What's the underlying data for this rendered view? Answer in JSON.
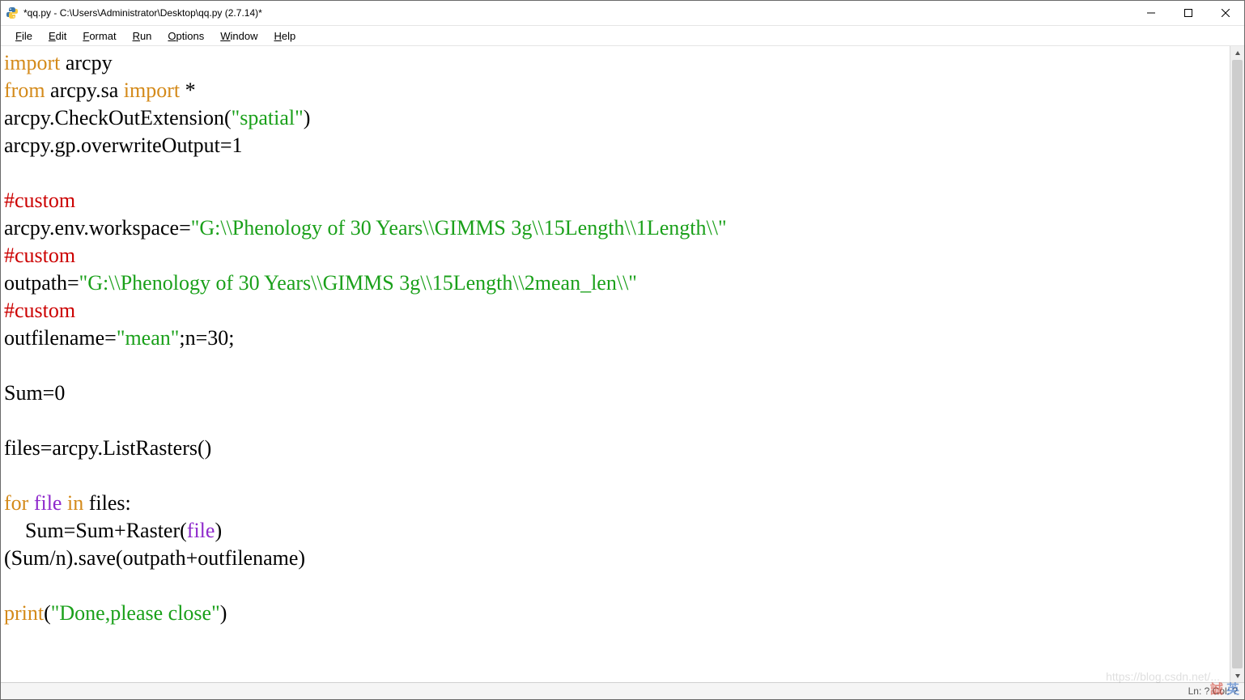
{
  "window": {
    "title": "*qq.py - C:\\Users\\Administrator\\Desktop\\qq.py (2.7.14)*"
  },
  "menu": {
    "file": {
      "u": "F",
      "rest": "ile"
    },
    "edit": {
      "u": "E",
      "rest": "dit"
    },
    "format": {
      "u": "F",
      "rest": "ormat"
    },
    "run": {
      "u": "R",
      "rest": "un"
    },
    "options": {
      "u": "O",
      "rest": "ptions"
    },
    "window": {
      "u": "W",
      "rest": "indow"
    },
    "help": {
      "u": "H",
      "rest": "elp"
    }
  },
  "code": {
    "l1_import": "import",
    "l1_rest": " arcpy",
    "l2_from": "from",
    "l2_mid": " arcpy.sa ",
    "l2_import": "import",
    "l2_end": " *",
    "l3_a": "arcpy.CheckOutExtension(",
    "l3_str": "\"spatial\"",
    "l3_b": ")",
    "l4": "arcpy.gp.overwriteOutput=1",
    "l5": "",
    "l6_com": "#custom",
    "l7_a": "arcpy.env.workspace=",
    "l7_str": "\"G:\\\\Phenology of 30 Years\\\\GIMMS 3g\\\\15Length\\\\1Length\\\\\"",
    "l8_com": "#custom",
    "l9_a": "outpath=",
    "l9_str": "\"G:\\\\Phenology of 30 Years\\\\GIMMS 3g\\\\15Length\\\\2mean_len\\\\\"",
    "l10_com": "#custom",
    "l11_a": "outfilename=",
    "l11_str": "\"mean\"",
    "l11_b": ";n=30;",
    "l12": "",
    "l13": "Sum=0",
    "l14": "",
    "l15": "files=arcpy.ListRasters()",
    "l16": "",
    "l17_for": "for",
    "l17_mid1": " ",
    "l17_file": "file",
    "l17_mid2": " ",
    "l17_in": "in",
    "l17_end": " files:",
    "l18_a": "    Sum=Sum+Raster(",
    "l18_file": "file",
    "l18_b": ")",
    "l19": "(Sum/n).save(outpath+outfilename)",
    "l20": "",
    "l21_print": "print",
    "l21_a": "(",
    "l21_str": "\"Done,please close\"",
    "l21_b": ")"
  },
  "status": {
    "text": "Ln: ?  Col: ?"
  },
  "watermark": "https://blog.csdn.net/...",
  "lang": {
    "a": "誠",
    "b": "英"
  }
}
